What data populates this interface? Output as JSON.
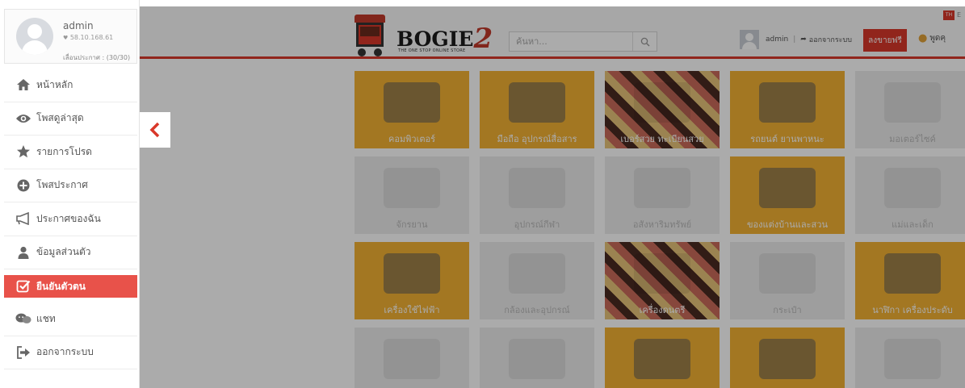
{
  "sidebar": {
    "profile": {
      "username": "admin",
      "ip": "58.10.168.61",
      "quota": "เลื่อนประกาศ : (30/30)"
    },
    "items": [
      {
        "label": "หน้าหลัก",
        "icon": "home-icon"
      },
      {
        "label": "โพสดูล่าสุด",
        "icon": "eye-icon"
      },
      {
        "label": "รายการโปรด",
        "icon": "star-icon"
      },
      {
        "label": "โพสประกาศ",
        "icon": "plus-circle-icon"
      },
      {
        "label": "ประกาศของฉัน",
        "icon": "megaphone-icon"
      },
      {
        "label": "ข้อมูลส่วนตัว",
        "icon": "user-icon"
      },
      {
        "label": "ยืนยันตัวตน",
        "icon": "check-square-icon",
        "active": true
      },
      {
        "label": "แชท",
        "icon": "chat-icon"
      },
      {
        "label": "ออกจากระบบ",
        "icon": "logout-icon"
      }
    ]
  },
  "header": {
    "brand": "BOGIE",
    "brand_suffix": "2",
    "tagline": "THE ONE STOP ONLINE STORE",
    "search_placeholder": "ค้นหา...",
    "user": "admin",
    "logout": "ออกจากระบบ",
    "sell_button": "ลงขายฟรี",
    "chat": "พูดคุ",
    "lang": "TH",
    "lang_more": "E"
  },
  "categories": [
    {
      "label": "คอมพิวเตอร์",
      "style": "y"
    },
    {
      "label": "มือถือ อุปกรณ์สื่อสาร",
      "style": "y"
    },
    {
      "label": "เบอร์สวย ทะเบียนสวย",
      "style": "d"
    },
    {
      "label": "รถยนต์ ยานพาหนะ",
      "style": "y"
    },
    {
      "label": "มอเตอร์ไซค์",
      "style": "l"
    },
    {
      "label": "จักรยาน",
      "style": "l"
    },
    {
      "label": "อุปกรณ์กีฬา",
      "style": "l"
    },
    {
      "label": "อสังหาริมทรัพย์",
      "style": "l"
    },
    {
      "label": "ของแต่งบ้านและสวน",
      "style": "y"
    },
    {
      "label": "แม่และเด็ก",
      "style": "l"
    },
    {
      "label": "เครื่องใช้ไฟฟ้า",
      "style": "y"
    },
    {
      "label": "กล้องและอุปกรณ์",
      "style": "l"
    },
    {
      "label": "เครื่องดนตรี",
      "style": "d"
    },
    {
      "label": "กระเป๋า",
      "style": "l"
    },
    {
      "label": "นาฬิกา เครื่องประดับ",
      "style": "y"
    },
    {
      "label": "",
      "style": "l"
    },
    {
      "label": "",
      "style": "l"
    },
    {
      "label": "",
      "style": "y"
    },
    {
      "label": "",
      "style": "y"
    },
    {
      "label": "",
      "style": "l"
    }
  ],
  "colors": {
    "accent": "#e8524a",
    "brand_red": "#d9382a",
    "tile_yellow": "#f3b234"
  }
}
